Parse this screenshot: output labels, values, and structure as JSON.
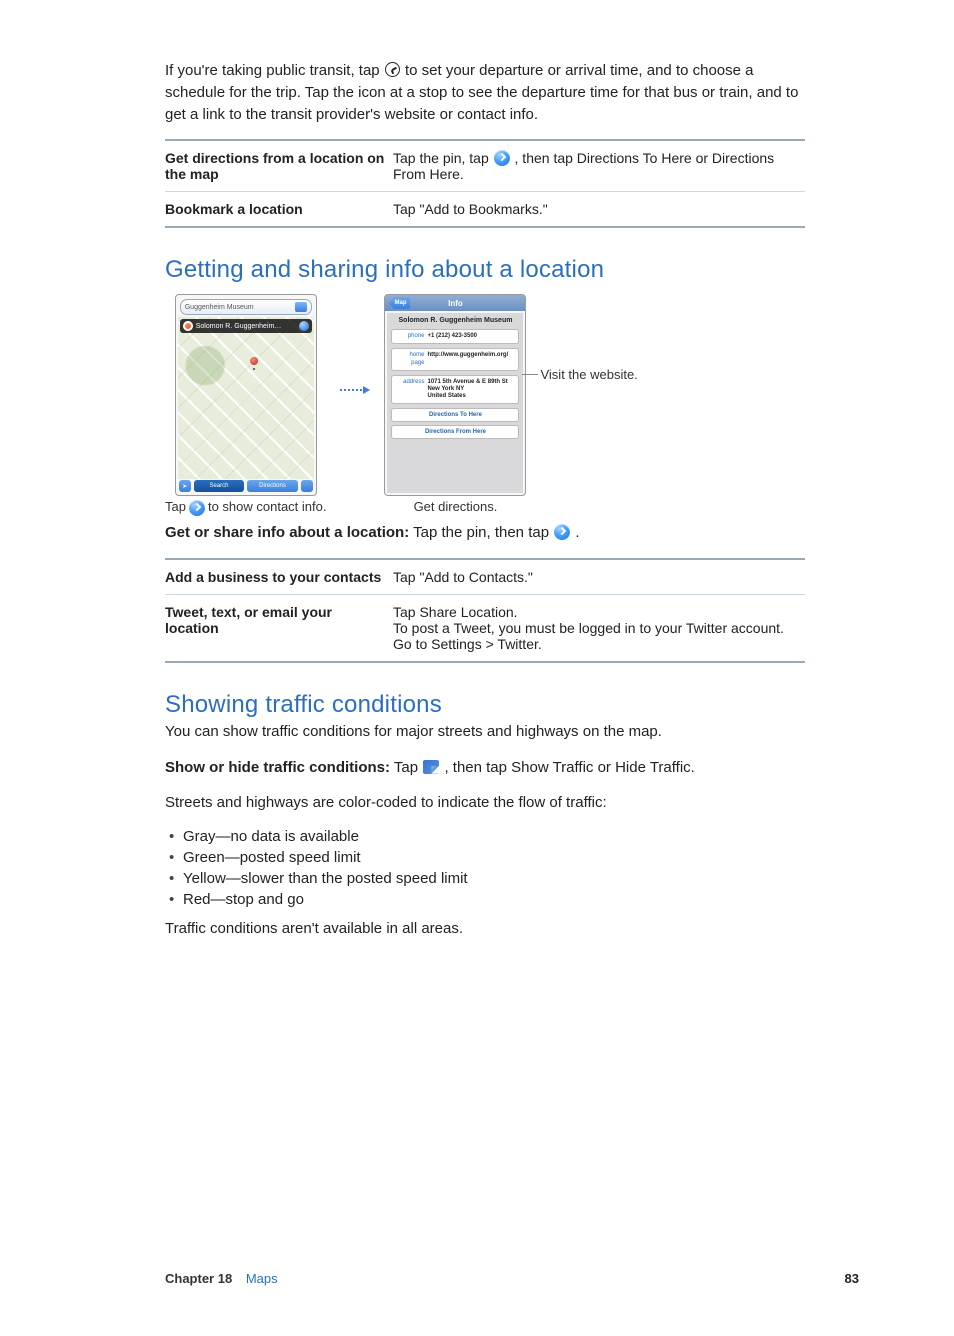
{
  "intro_para": "If you're taking public transit, tap  to set your departure or arrival time, and to choose a schedule for the trip. Tap the icon at a stop to see the departure time for that bus or train, and to get a link to the transit provider's website or contact info.",
  "table1": [
    {
      "label": "Get directions from a location on the map",
      "value": "Tap the pin, tap , then tap Directions To Here or Directions From Here."
    },
    {
      "label": "Bookmark a location",
      "value": "Tap \"Add to Bookmarks.\""
    }
  ],
  "h2a": "Getting and sharing info about a location",
  "figure": {
    "left": {
      "search_label": "Guggenheim Museum",
      "pin_label": "Solomon R. Guggenheim…",
      "btn_arrow": "↶",
      "btn_search": "Search",
      "btn_directions": "Directions",
      "btn_curl": "",
      "caption_pre": "Tap ",
      "caption_post": " to show contact info."
    },
    "right": {
      "header_back": "Map",
      "header_title": "Info",
      "title": "Solomon R. Guggenheim Museum",
      "rows": [
        {
          "lbl": "phone",
          "val": "+1 (212) 423-3500"
        },
        {
          "lbl": "home page",
          "val": "http://www.guggenheim.org/"
        },
        {
          "lbl": "address",
          "val": "1071 5th Avenue & E 89th St\nNew York NY\nUnited States"
        }
      ],
      "btn1": "Directions To Here",
      "btn2": "Directions From Here",
      "caption": "Get directions."
    },
    "side_label": "Visit the website."
  },
  "get_share_lead": "Get or share info about a location:",
  "get_share_rest": "  Tap the pin, then tap ",
  "get_share_end": ".",
  "table2": [
    {
      "label": "Add a business to your contacts",
      "value": "Tap \"Add to Contacts.\""
    },
    {
      "label": "Tweet, text, or email your location",
      "value": "Tap Share Location.\nTo post a Tweet, you must be logged in to your Twitter account. Go to Settings > Twitter."
    }
  ],
  "h2b": "Showing traffic conditions",
  "traffic_p1": "You can show traffic conditions for major streets and highways on the map.",
  "traffic_lead": "Show or hide traffic conditions:",
  "traffic_rest_a": "  Tap ",
  "traffic_rest_b": ", then tap Show Traffic or Hide Traffic.",
  "traffic_p2": "Streets and highways are color-coded to indicate the flow of traffic:",
  "traffic_list": [
    "Gray—no data is available",
    "Green—posted speed limit",
    "Yellow—slower than the posted speed limit",
    "Red—stop and go"
  ],
  "traffic_p3": "Traffic conditions aren't available in all areas.",
  "footer": {
    "chapter": "Chapter 18",
    "name": "Maps",
    "page": "83"
  }
}
